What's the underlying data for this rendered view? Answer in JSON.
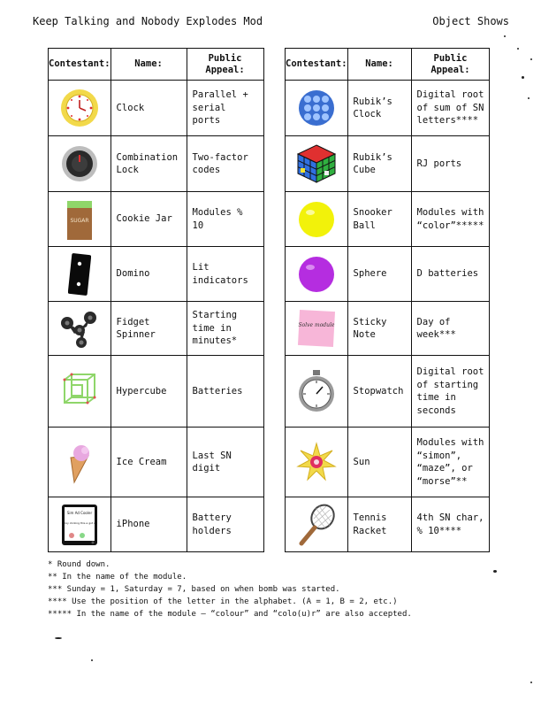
{
  "header": {
    "mod_title": "Keep Talking and Nobody Explodes Mod",
    "module_name": "Object Shows"
  },
  "columns": {
    "contestant": "Contestant:",
    "name": "Name:",
    "appeal": "Public Appeal:"
  },
  "left_rows": [
    {
      "name": "Clock",
      "appeal": "Parallel + serial ports",
      "icon": "clock-icon"
    },
    {
      "name": "Combination Lock",
      "appeal": "Two-factor codes",
      "icon": "combination-lock-icon"
    },
    {
      "name": "Cookie Jar",
      "appeal": "Modules % 10",
      "icon": "cookie-jar-icon",
      "jar_label": "SUGAR"
    },
    {
      "name": "Domino",
      "appeal": "Lit indicators",
      "icon": "domino-icon"
    },
    {
      "name": "Fidget Spinner",
      "appeal": "Starting time in minutes*",
      "icon": "fidget-spinner-icon"
    },
    {
      "name": "Hypercube",
      "appeal": "Batteries",
      "icon": "hypercube-icon"
    },
    {
      "name": "Ice Cream",
      "appeal": "Last SN digit",
      "icon": "ice-cream-icon"
    },
    {
      "name": "iPhone",
      "appeal": "Battery holders",
      "icon": "iphone-icon",
      "screen_line1": "Sim Ad Cooler",
      "screen_line2": "Boxy clicking this a got all"
    }
  ],
  "right_rows": [
    {
      "name": "Rubik’s Clock",
      "appeal": "Digital root of sum of SN letters****",
      "icon": "rubiks-clock-icon"
    },
    {
      "name": "Rubik’s Cube",
      "appeal": "RJ ports",
      "icon": "rubiks-cube-icon"
    },
    {
      "name": "Snooker Ball",
      "appeal": "Modules with “color”*****",
      "icon": "snooker-ball-icon"
    },
    {
      "name": "Sphere",
      "appeal": "D batteries",
      "icon": "sphere-icon"
    },
    {
      "name": "Sticky Note",
      "appeal": "Day of week***",
      "icon": "sticky-note-icon",
      "note_text": "Solve module"
    },
    {
      "name": "Stopwatch",
      "appeal": "Digital root of starting time in seconds",
      "icon": "stopwatch-icon"
    },
    {
      "name": "Sun",
      "appeal": "Modules with “simon”, “maze”, or “morse”**",
      "icon": "sun-icon"
    },
    {
      "name": "Tennis Racket",
      "appeal": "4th SN char, % 10****",
      "icon": "tennis-racket-icon"
    }
  ],
  "footnotes": [
    "* Round down.",
    "** In the name of the module.",
    "*** Sunday = 1, Saturday = 7, based on when bomb was started.",
    "**** Use the position of the letter in the alphabet. (A = 1, B = 2, etc.)",
    "***** In the name of the module — “colour” and “colo(u)r” are also accepted."
  ],
  "colors": {
    "ink": "#111111",
    "sticky_note": "#f7b6d8",
    "snooker_ball": "#f2f20a",
    "sphere": "#b52de0",
    "cookie_jar": "#a0693a"
  }
}
